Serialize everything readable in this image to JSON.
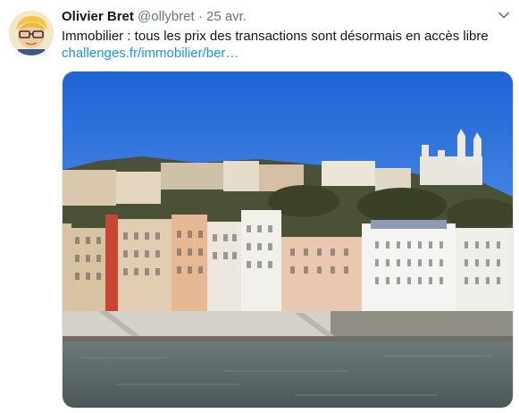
{
  "tweet": {
    "author_name": "Olivier Bret",
    "handle": "@ollybret",
    "separator": "·",
    "date": "25 avr.",
    "text": "Immobilier : tous les prix des transactions sont désormais en accès libre",
    "link_text": "challenges.fr/immobilier/ber…"
  },
  "icons": {
    "menu": "chevron-down-icon",
    "avatar": "cartoon-avatar"
  },
  "colors": {
    "link": "#1b95e0",
    "muted": "#657786",
    "text": "#14171a"
  }
}
